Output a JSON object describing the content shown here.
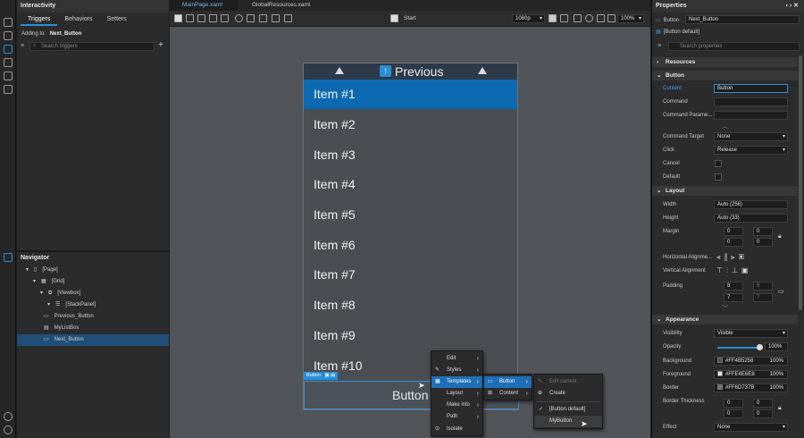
{
  "left": {
    "title": "Interactivity",
    "tabs": [
      "Triggers",
      "Behaviors",
      "Setters"
    ],
    "adding_to_label": "Adding to:",
    "adding_to_value": "Next_Button",
    "search_placeholder": "Search triggers"
  },
  "navigator": {
    "title": "Navigator",
    "rows": [
      "[Page]",
      "[Grid]",
      "[Viewbox]",
      "[StackPanel]",
      "Previous_Button",
      "MyListBox",
      "Next_Button"
    ]
  },
  "doc_tabs": [
    "MainPage.xaml",
    "GlobalResources.xaml"
  ],
  "toolbar": {
    "start_label": "Start",
    "resolution": "1080p",
    "zoom": "100%"
  },
  "phone": {
    "previous_label": "Previous",
    "items": [
      "Item #1",
      "Item #2",
      "Item #3",
      "Item #4",
      "Item #5",
      "Item #6",
      "Item #7",
      "Item #8",
      "Item #9",
      "Item #10"
    ],
    "button_label": "Button",
    "adorner_label": "Button"
  },
  "context_menu": {
    "main": [
      "Edit",
      "Styles",
      "Templates",
      "Layout",
      "Make into",
      "Path",
      "Isolate"
    ],
    "templates_sub": [
      "Button",
      "Content"
    ],
    "button_sub": [
      "Edit current",
      "Create",
      "[Button default]",
      "MyButton"
    ]
  },
  "properties": {
    "title": "Properties",
    "element_type": "Button",
    "element_name": "Next_Button",
    "style_label": "[Button default]",
    "search_placeholder": "Search properties",
    "sections": {
      "resources": "Resources",
      "button": "Button",
      "layout": "Layout",
      "appearance": "Appearance"
    },
    "button_props": {
      "content_label": "Content",
      "content_value": "Button",
      "command_label": "Command",
      "command_param_label": "Command Parame...",
      "command_target_label": "Command Target",
      "command_target_value": "None",
      "click_label": "Click",
      "click_value": "Release",
      "cancel_label": "Cancel",
      "default_label": "Default"
    },
    "layout_props": {
      "width_label": "Width",
      "width_value": "Auto (256)",
      "height_label": "Height",
      "height_value": "Auto (33)",
      "margin_label": "Margin",
      "margin_values": [
        "0",
        "0",
        "0",
        "0"
      ],
      "halign_label": "Horizontal Alignme...",
      "valign_label": "Vertical Alignment",
      "padding_label": "Padding",
      "padding_values": [
        "8",
        "6",
        "7",
        "7"
      ]
    },
    "appearance_props": {
      "visibility_label": "Visibility",
      "visibility_value": "Visible",
      "opacity_label": "Opacity",
      "opacity_value": "100%",
      "background_label": "Background",
      "background_value": "#FF4B5258",
      "background_pct": "100%",
      "foreground_label": "Foreground",
      "foreground_value": "#FFE4E6E8",
      "foreground_pct": "100%",
      "border_label": "Border",
      "border_value": "#FF6D737B",
      "border_pct": "100%",
      "border_thickness_label": "Border Thickness",
      "border_thickness_values": [
        "0",
        "0",
        "0",
        "0"
      ],
      "effect_label": "Effect",
      "effect_value": "None"
    }
  },
  "colors": {
    "accent": "#0d6ab1",
    "selection": "#1f6fb8",
    "canvas": "#515458"
  }
}
